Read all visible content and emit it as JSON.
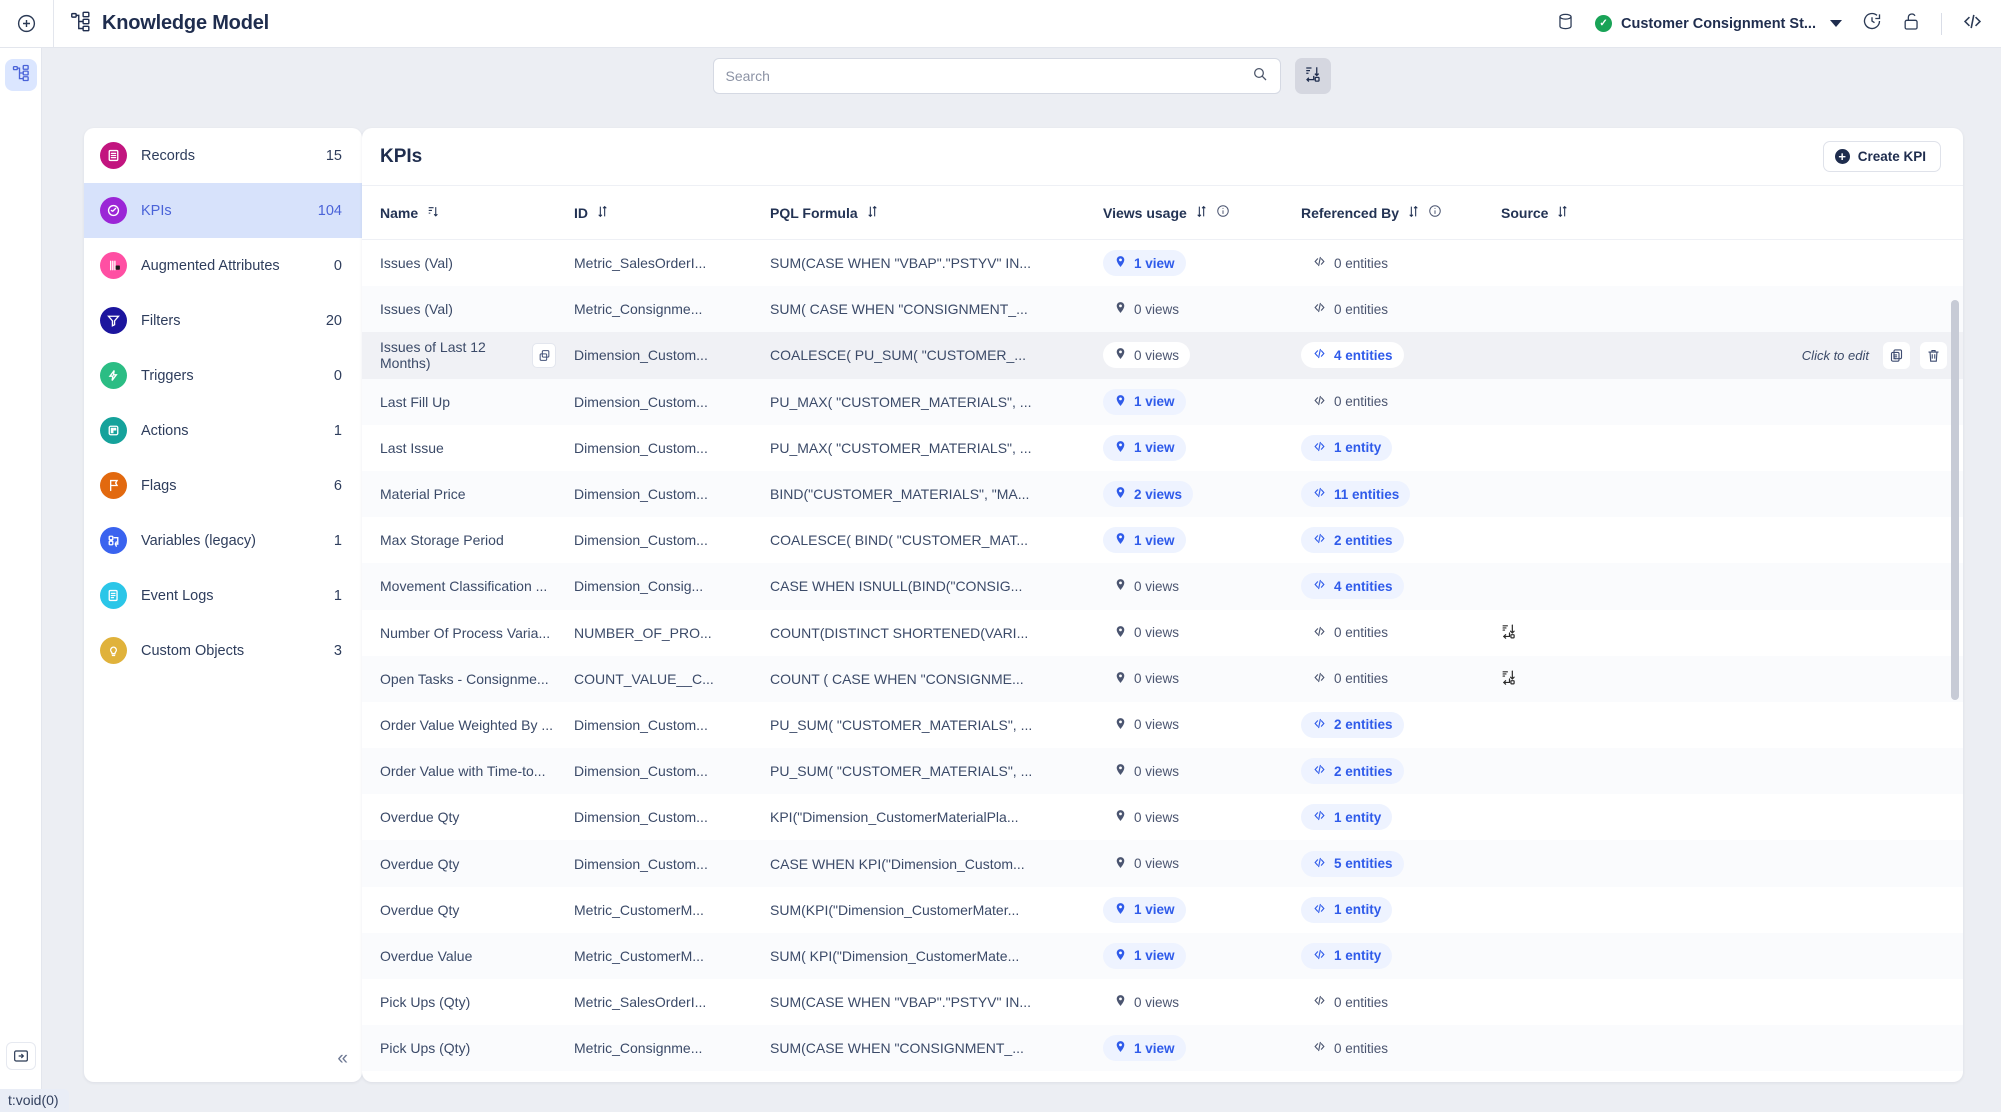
{
  "topbar": {
    "add_icon": "plus-circle-icon",
    "app_icon": "knowledge-model-icon",
    "title": "Knowledge Model",
    "database_icon": "database-icon",
    "workspace_label": "Customer Consignment St...",
    "workspace_status": "✓",
    "history_icon": "history-clock-icon",
    "lock_icon": "unlock-icon",
    "code_icon": "code-brackets-icon"
  },
  "rail": {
    "item_icon": "knowledge-model-icon",
    "collapse_icon": "panel-expand-icon"
  },
  "search": {
    "placeholder": "Search",
    "value": "",
    "search_icon": "search-icon",
    "filter_icon": "sort-transform-icon"
  },
  "sidebar": {
    "items": [
      {
        "label": "Records",
        "count": "15",
        "icon": "records-icon",
        "color": "#c2157f",
        "active": false
      },
      {
        "label": "KPIs",
        "count": "104",
        "icon": "kpis-icon",
        "color": "#9b26d6",
        "active": true
      },
      {
        "label": "Augmented Attributes",
        "count": "0",
        "icon": "augmented-attributes-icon",
        "color": "#ff4fa3",
        "active": false
      },
      {
        "label": "Filters",
        "count": "20",
        "icon": "filters-icon",
        "color": "#1c159e",
        "active": false
      },
      {
        "label": "Triggers",
        "count": "0",
        "icon": "triggers-icon",
        "color": "#2bbd84",
        "active": false
      },
      {
        "label": "Actions",
        "count": "1",
        "icon": "actions-icon",
        "color": "#15a29b",
        "active": false
      },
      {
        "label": "Flags",
        "count": "6",
        "icon": "flags-icon",
        "color": "#e2690f",
        "active": false
      },
      {
        "label": "Variables (legacy)",
        "count": "1",
        "icon": "variables-icon",
        "color": "#3a63ef",
        "active": false
      },
      {
        "label": "Event Logs",
        "count": "1",
        "icon": "event-logs-icon",
        "color": "#2bc6e8",
        "active": false
      },
      {
        "label": "Custom Objects",
        "count": "3",
        "icon": "custom-objects-icon",
        "color": "#e0b23b",
        "active": false
      }
    ],
    "collapse_label": "«"
  },
  "main": {
    "title": "KPIs",
    "create_button": "Create KPI",
    "columns": [
      {
        "label": "Name",
        "sort_icon": "sort-desc-icon"
      },
      {
        "label": "ID",
        "sort_icon": "sort-both-icon"
      },
      {
        "label": "PQL Formula",
        "sort_icon": "sort-both-icon"
      },
      {
        "label": "Views usage",
        "sort_icon": "sort-both-icon",
        "info_icon": "info-icon"
      },
      {
        "label": "Referenced By",
        "sort_icon": "sort-both-icon",
        "info_icon": "info-icon"
      },
      {
        "label": "Source",
        "sort_icon": "sort-both-icon"
      }
    ],
    "row_actions": {
      "hint": "Click to edit",
      "duplicate_icon": "duplicate-icon",
      "delete_icon": "trash-icon"
    },
    "rows": [
      {
        "name": "Issues (Val)",
        "id": "Metric_SalesOrderI...",
        "pql": "SUM(CASE WHEN \"VBAP\".\"PSTYV\" IN...",
        "views": "1 view",
        "views_active": true,
        "refs": "0 entities",
        "refs_active": false,
        "source": ""
      },
      {
        "name": "Issues (Val)",
        "id": "Metric_Consignme...",
        "pql": "SUM( CASE WHEN \"CONSIGNMENT_...",
        "views": "0 views",
        "views_active": false,
        "refs": "0 entities",
        "refs_active": false,
        "source": ""
      },
      {
        "name": "Issues of Last 12 Months)",
        "id": "Dimension_Custom...",
        "pql": "COALESCE( PU_SUM( \"CUSTOMER_...",
        "views": "0 views",
        "views_active": false,
        "refs": "4 entities",
        "refs_active": true,
        "source": "",
        "hovered": true,
        "has_copy": true
      },
      {
        "name": "Last Fill Up",
        "id": "Dimension_Custom...",
        "pql": "PU_MAX( \"CUSTOMER_MATERIALS\", ...",
        "views": "1 view",
        "views_active": true,
        "refs": "0 entities",
        "refs_active": false,
        "source": ""
      },
      {
        "name": "Last Issue",
        "id": "Dimension_Custom...",
        "pql": "PU_MAX( \"CUSTOMER_MATERIALS\", ...",
        "views": "1 view",
        "views_active": true,
        "refs": "1 entity",
        "refs_active": true,
        "source": ""
      },
      {
        "name": "Material Price",
        "id": "Dimension_Custom...",
        "pql": "BIND(\"CUSTOMER_MATERIALS\", \"MA...",
        "views": "2 views",
        "views_active": true,
        "refs": "11 entities",
        "refs_active": true,
        "source": ""
      },
      {
        "name": "Max Storage Period",
        "id": "Dimension_Custom...",
        "pql": "COALESCE( BIND( \"CUSTOMER_MAT...",
        "views": "1 view",
        "views_active": true,
        "refs": "2 entities",
        "refs_active": true,
        "source": ""
      },
      {
        "name": "Movement Classification ...",
        "id": "Dimension_Consig...",
        "pql": "CASE WHEN ISNULL(BIND(\"CONSIG...",
        "views": "0 views",
        "views_active": false,
        "refs": "4 entities",
        "refs_active": true,
        "source": ""
      },
      {
        "name": "Number Of Process Varia...",
        "id": "NUMBER_OF_PRO...",
        "pql": "COUNT(DISTINCT SHORTENED(VARI...",
        "views": "0 views",
        "views_active": false,
        "refs": "0 entities",
        "refs_active": false,
        "source": "transform-icon"
      },
      {
        "name": "Open Tasks - Consignme...",
        "id": "COUNT_VALUE__C...",
        "pql": "COUNT ( CASE WHEN \"CONSIGNME...",
        "views": "0 views",
        "views_active": false,
        "refs": "0 entities",
        "refs_active": false,
        "source": "transform-icon"
      },
      {
        "name": "Order Value Weighted By ...",
        "id": "Dimension_Custom...",
        "pql": "PU_SUM( \"CUSTOMER_MATERIALS\", ...",
        "views": "0 views",
        "views_active": false,
        "refs": "2 entities",
        "refs_active": true,
        "source": ""
      },
      {
        "name": "Order Value with Time-to...",
        "id": "Dimension_Custom...",
        "pql": "PU_SUM( \"CUSTOMER_MATERIALS\", ...",
        "views": "0 views",
        "views_active": false,
        "refs": "2 entities",
        "refs_active": true,
        "source": ""
      },
      {
        "name": "Overdue Qty",
        "id": "Dimension_Custom...",
        "pql": "KPI(\"Dimension_CustomerMaterialPla...",
        "views": "0 views",
        "views_active": false,
        "refs": "1 entity",
        "refs_active": true,
        "source": ""
      },
      {
        "name": "Overdue Qty",
        "id": "Dimension_Custom...",
        "pql": "CASE WHEN KPI(\"Dimension_Custom...",
        "views": "0 views",
        "views_active": false,
        "refs": "5 entities",
        "refs_active": true,
        "source": ""
      },
      {
        "name": "Overdue Qty",
        "id": "Metric_CustomerM...",
        "pql": "SUM(KPI(\"Dimension_CustomerMater...",
        "views": "1 view",
        "views_active": true,
        "refs": "1 entity",
        "refs_active": true,
        "source": ""
      },
      {
        "name": "Overdue Value",
        "id": "Metric_CustomerM...",
        "pql": "SUM( KPI(\"Dimension_CustomerMate...",
        "views": "1 view",
        "views_active": true,
        "refs": "1 entity",
        "refs_active": true,
        "source": ""
      },
      {
        "name": "Pick Ups (Qty)",
        "id": "Metric_SalesOrderI...",
        "pql": "SUM(CASE WHEN \"VBAP\".\"PSTYV\" IN...",
        "views": "0 views",
        "views_active": false,
        "refs": "0 entities",
        "refs_active": false,
        "source": ""
      },
      {
        "name": "Pick Ups (Qty)",
        "id": "Metric_Consignme...",
        "pql": "SUM(CASE WHEN \"CONSIGNMENT_...",
        "views": "1 view",
        "views_active": true,
        "refs": "0 entities",
        "refs_active": false,
        "source": ""
      }
    ]
  },
  "statusbar": {
    "text": "t:void(0)"
  },
  "colors": {
    "accent": "#2f5bea",
    "active_bg": "#d7e2fb",
    "title": "#1f2d4e",
    "page_bg": "#eceef3"
  }
}
